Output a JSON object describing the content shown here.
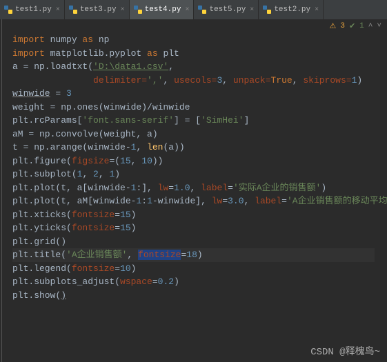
{
  "tabs": [
    {
      "label": "test1.py",
      "active": false
    },
    {
      "label": "test3.py",
      "active": false
    },
    {
      "label": "test4.py",
      "active": true
    },
    {
      "label": "test5.py",
      "active": false
    },
    {
      "label": "test2.py",
      "active": false
    }
  ],
  "status": {
    "warn_count": "3",
    "ok_count": "1"
  },
  "code": {
    "l1": {
      "kw1": "import",
      "pkg": " numpy ",
      "kw2": "as",
      "alias": " np"
    },
    "l2": {
      "kw1": "import",
      "pkg": " matplotlib.pyplot ",
      "kw2": "as",
      "alias": " plt"
    },
    "l3": "",
    "l4": {
      "a": "a = np.loadtxt(",
      "path": "'D:\\data1.csv'",
      "c": ","
    },
    "l5": {
      "pad": "               ",
      "d": "delimiter=",
      "s": "','",
      "c": ", ",
      "u": "usecols=",
      "n3": "3",
      "c2": ", ",
      "up": "unpack=",
      "tr": "True",
      "c3": ", ",
      "sk": "skiprows=",
      "n1": "1",
      "rp": ")"
    },
    "l6": {
      "var": "winwide",
      "rest": " = ",
      "n": "3"
    },
    "l7": {
      "var": "weight = np.ones(winwide)/winwide"
    },
    "l8": "",
    "l9": {
      "a": "plt.rcParams[",
      "s1": "'font.sans-serif'",
      "b": "] = [",
      "s2": "'SimHei'",
      "c": "]"
    },
    "l10": {
      "a": "aM = np.convolve(weight, a)"
    },
    "l11": {
      "a": "t = np.arange(winwide-",
      "n1": "1",
      "b": ", ",
      "fn": "len",
      "c": "(a))"
    },
    "l12": {
      "a": "plt.figure(",
      "p": "figsize",
      "eq": "=(",
      "n1": "15",
      "c": ", ",
      "n2": "10",
      "rp": "))"
    },
    "l13": "",
    "l14": {
      "a": "plt.subplot(",
      "n1": "1",
      "c1": ", ",
      "n2": "2",
      "c2": ", ",
      "n3": "1",
      "rp": ")"
    },
    "l15": {
      "a": "plt.plot(t, a[winwide-",
      "n1": "1",
      "b": ":], ",
      "lw": "lw",
      "eq": "=",
      "nv": "1.0",
      "c": ", ",
      "lb": "label",
      "eq2": "=",
      "s": "'实际A企业的销售额'",
      "rp": ")"
    },
    "l16": {
      "a": "plt.plot(t, aM[winwide-",
      "n1": "1",
      "b": ":",
      "n2": "1",
      "c": "-winwide], ",
      "lw": "lw",
      "eq": "=",
      "nv": "3.0",
      "cc": ", ",
      "lb": "label",
      "eq2": "=",
      "s": "'A企业销售额的移动平均值'",
      "rp": ")"
    },
    "l17": "",
    "l18": {
      "a": "plt.xticks(",
      "p": "fontsize",
      "eq": "=",
      "n": "15",
      "rp": ")"
    },
    "l19": {
      "a": "plt.yticks(",
      "p": "fontsize",
      "eq": "=",
      "n": "15",
      "rp": ")"
    },
    "l20": {
      "a": "plt.grid()"
    },
    "l21": {
      "a": "plt.title(",
      "s": "'A企业销售额'",
      "c": ", ",
      "p": "fontsize",
      "eq": "=",
      "n": "18",
      "rp": ")"
    },
    "l22": {
      "a": "plt.legend(",
      "p": "fontsize",
      "eq": "=",
      "n": "10",
      "rp": ")"
    },
    "l23": "",
    "l24": {
      "a": "plt.subplots_adjust(",
      "p": "wspace",
      "eq": "=",
      "n": "0.2",
      "rp": ")"
    },
    "l25": {
      "a": "plt.show(",
      "rp": ")"
    }
  },
  "watermark": "CSDN @释槐鸟~"
}
